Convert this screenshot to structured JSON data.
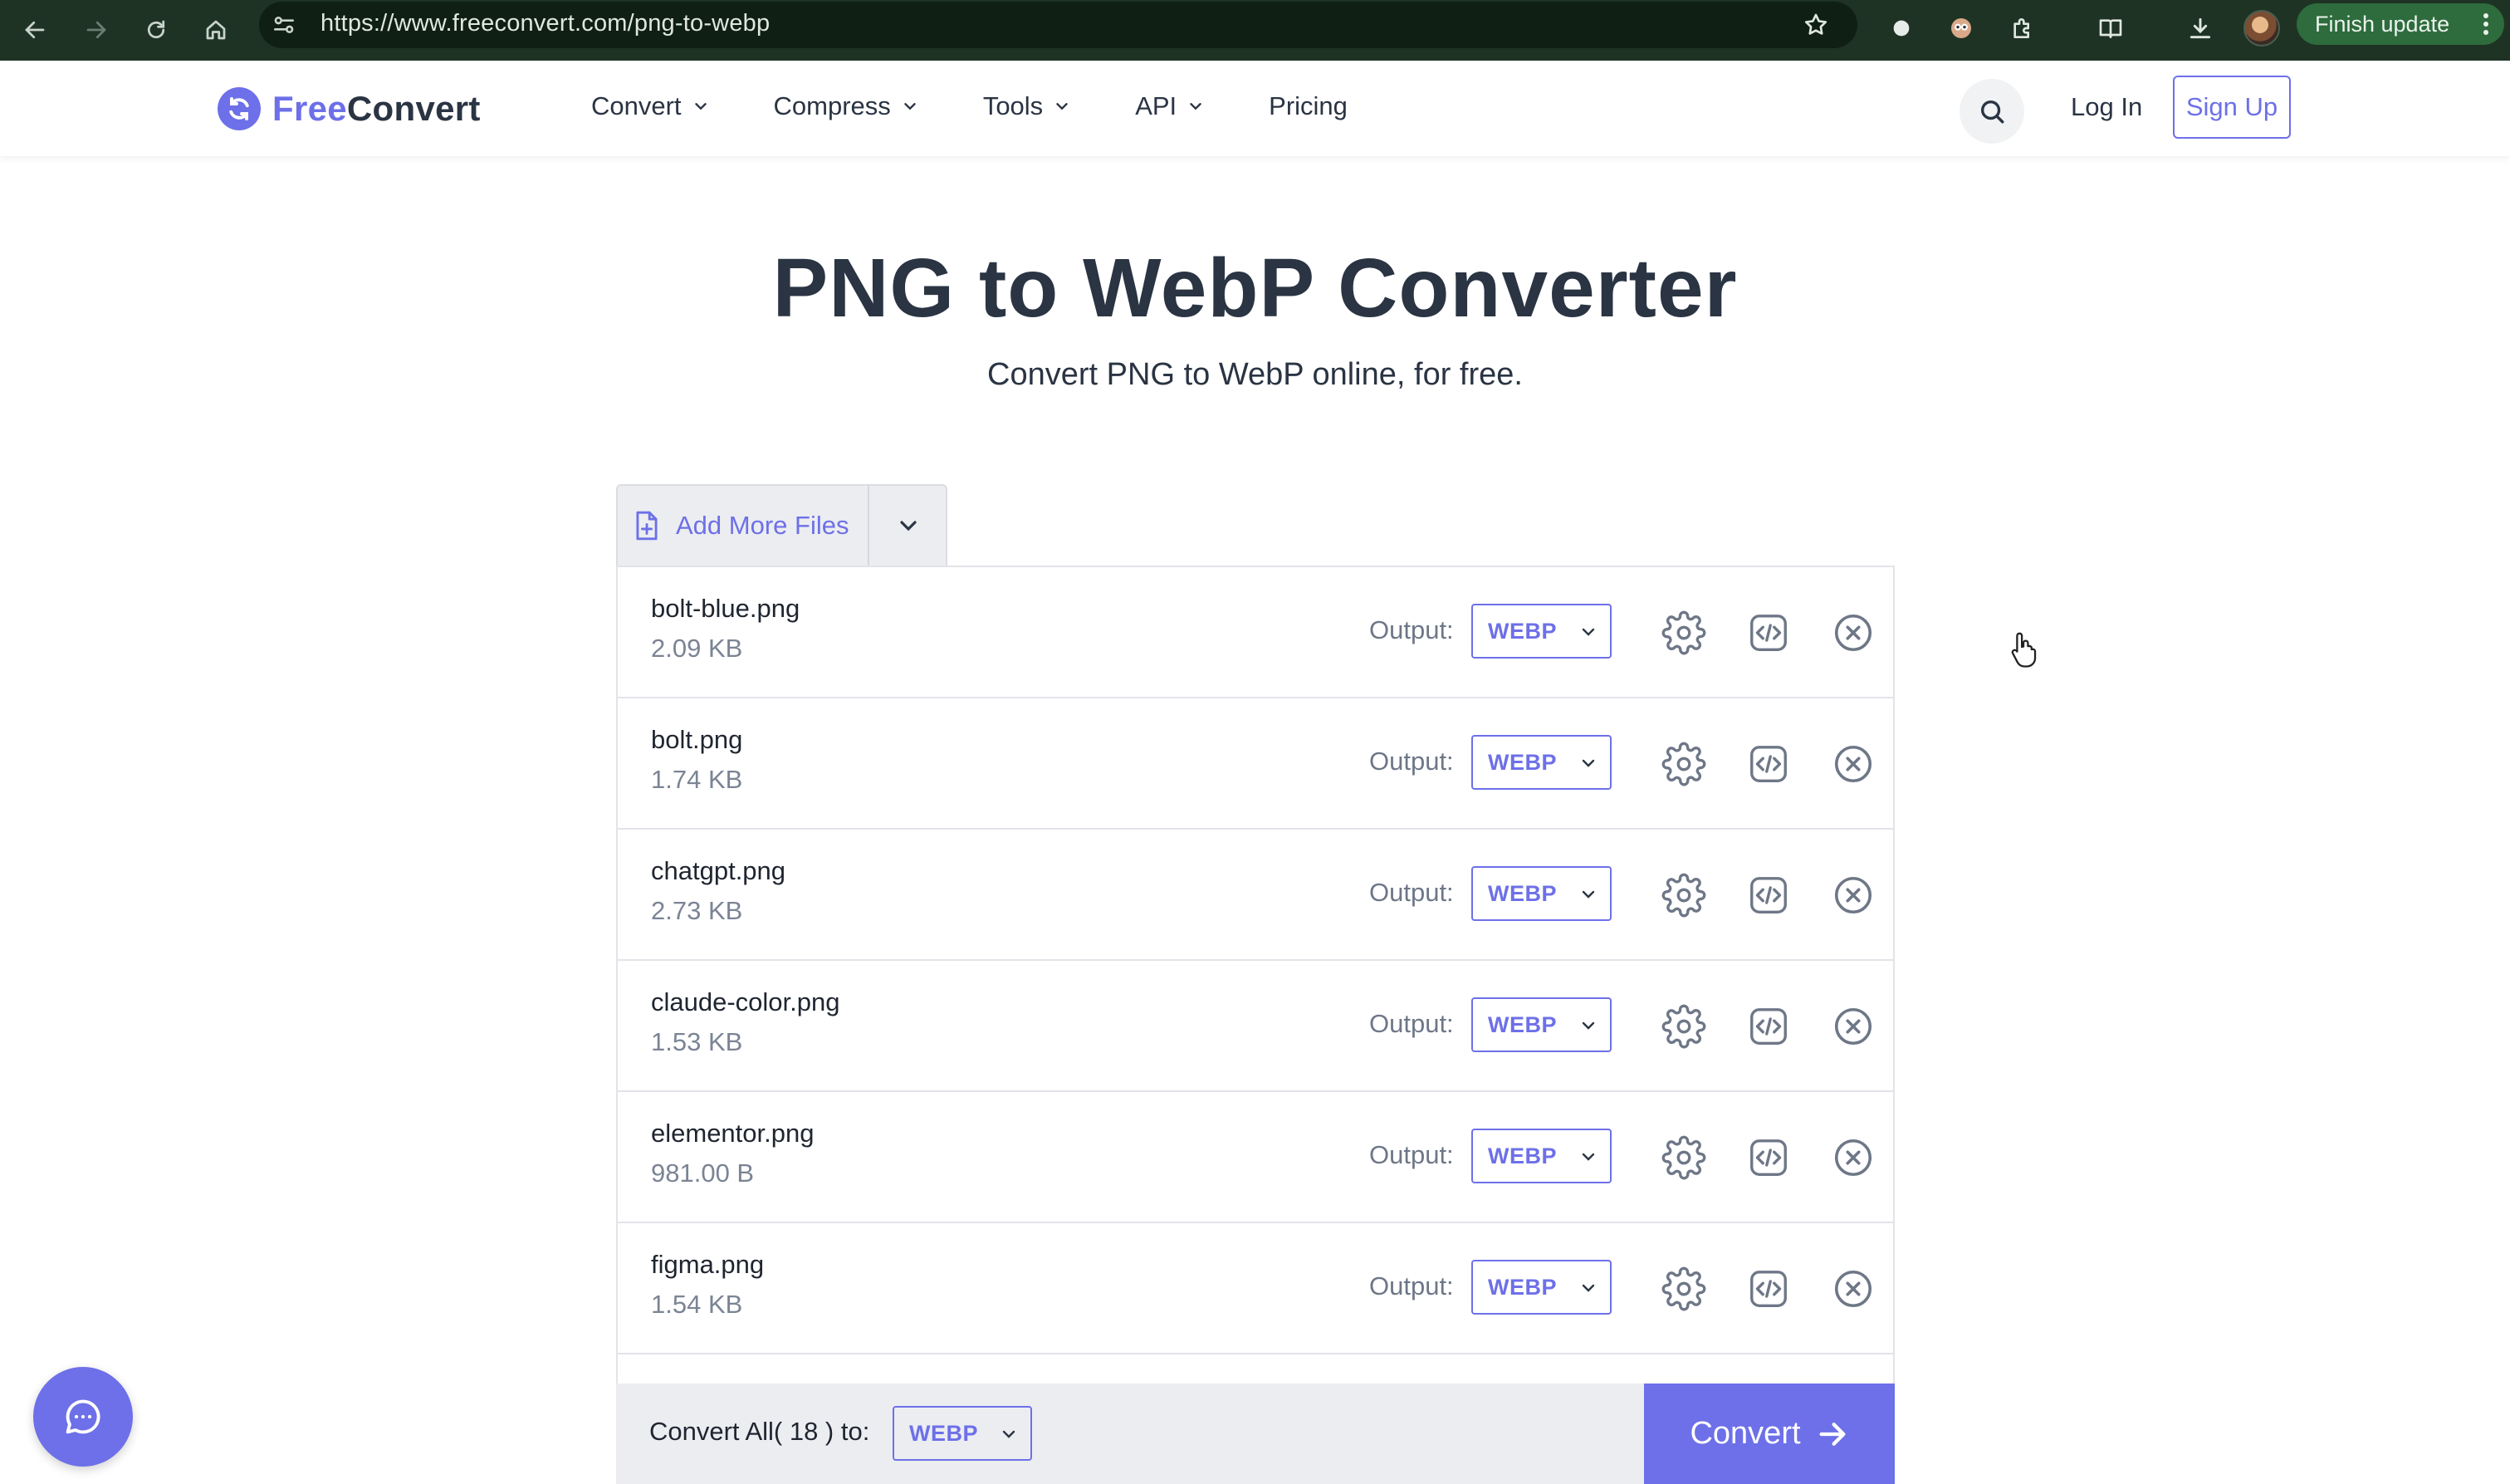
{
  "browser": {
    "url": "https://www.freeconvert.com/png-to-webp",
    "finish_update_label": "Finish update"
  },
  "header": {
    "logo_free": "Free",
    "logo_convert": "Convert",
    "nav": [
      {
        "label": "Convert"
      },
      {
        "label": "Compress"
      },
      {
        "label": "Tools"
      },
      {
        "label": "API"
      },
      {
        "label": "Pricing"
      }
    ],
    "login_label": "Log In",
    "signup_label": "Sign Up"
  },
  "hero": {
    "title": "PNG to WebP Converter",
    "subtitle": "Convert PNG to WebP online, for free."
  },
  "uploader": {
    "add_files_label": "Add More Files",
    "output_label": "Output:",
    "files": [
      {
        "name": "bolt-blue.png",
        "size": "2.09 KB",
        "format": "WEBP"
      },
      {
        "name": "bolt.png",
        "size": "1.74 KB",
        "format": "WEBP"
      },
      {
        "name": "chatgpt.png",
        "size": "2.73 KB",
        "format": "WEBP"
      },
      {
        "name": "claude-color.png",
        "size": "1.53 KB",
        "format": "WEBP"
      },
      {
        "name": "elementor.png",
        "size": "981.00 B",
        "format": "WEBP"
      },
      {
        "name": "figma.png",
        "size": "1.54 KB",
        "format": "WEBP"
      }
    ]
  },
  "convert_bar": {
    "convert_all_label": "Convert All( 18 ) to:",
    "format": "WEBP",
    "convert_button_label": "Convert"
  },
  "colors": {
    "brand": "#6d70e8",
    "chrome_bg": "#1e3324",
    "text_dark": "#2a3443"
  }
}
